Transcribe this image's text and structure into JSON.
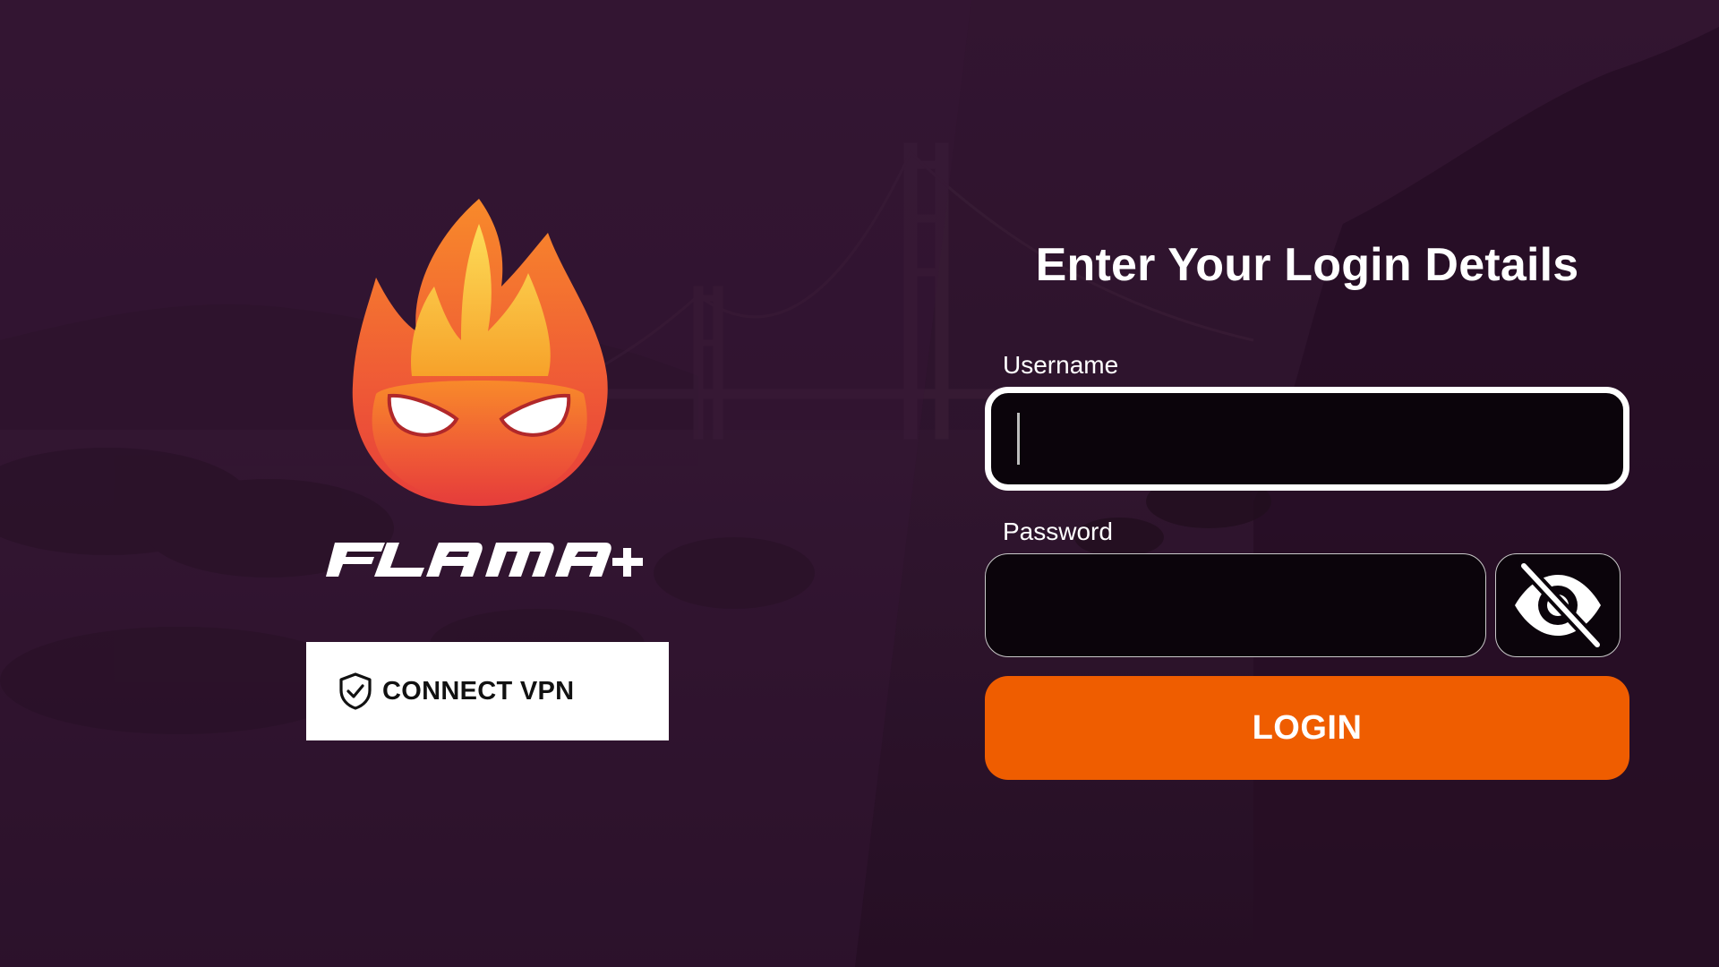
{
  "app": {
    "brand_name": "FLAMA+"
  },
  "vpn": {
    "label": "CONNECT VPN",
    "icon": "shield-check-icon"
  },
  "login": {
    "title": "Enter Your Login Details",
    "username_label": "Username",
    "username_value": "",
    "password_label": "Password",
    "password_value": "",
    "toggle_icon": "eye-off-icon",
    "submit_label": "LOGIN"
  },
  "colors": {
    "accent": "#ef5d00",
    "background": "#2f142e",
    "field_background": "#0b040b",
    "vpn_button_background": "#ffffff"
  }
}
